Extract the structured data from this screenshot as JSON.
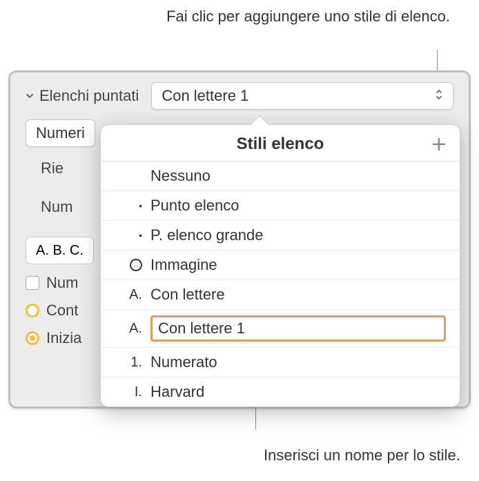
{
  "callouts": {
    "top": "Fai clic per aggiungere uno stile di elenco.",
    "bottom": "Inserisci un nome per lo stile."
  },
  "panel": {
    "section_label": "Elenchi puntati",
    "style_popup_value": "Con lettere 1",
    "truncated1": "Numeri",
    "label_indent": "Rie",
    "label_numbers": "Num",
    "format_example": "A. B. C.",
    "checkbox_label": "Num",
    "radio_cont": "Cont",
    "radio_init": "Inizia"
  },
  "popover": {
    "title": "Stili elenco",
    "items": [
      {
        "marker": "",
        "label": "Nessuno",
        "type": "none"
      },
      {
        "marker": "•",
        "label": "Punto elenco",
        "type": "bullet"
      },
      {
        "marker": "•",
        "label": "P. elenco grande",
        "type": "bullet"
      },
      {
        "marker": "○",
        "label": "Immagine",
        "type": "image"
      },
      {
        "marker": "A.",
        "label": "Con lettere",
        "type": "letter"
      },
      {
        "marker": "A.",
        "label": "Con lettere 1",
        "type": "letter",
        "editing": true
      },
      {
        "marker": "1.",
        "label": "Numerato",
        "type": "number"
      },
      {
        "marker": "I.",
        "label": "Harvard",
        "type": "roman"
      }
    ]
  }
}
